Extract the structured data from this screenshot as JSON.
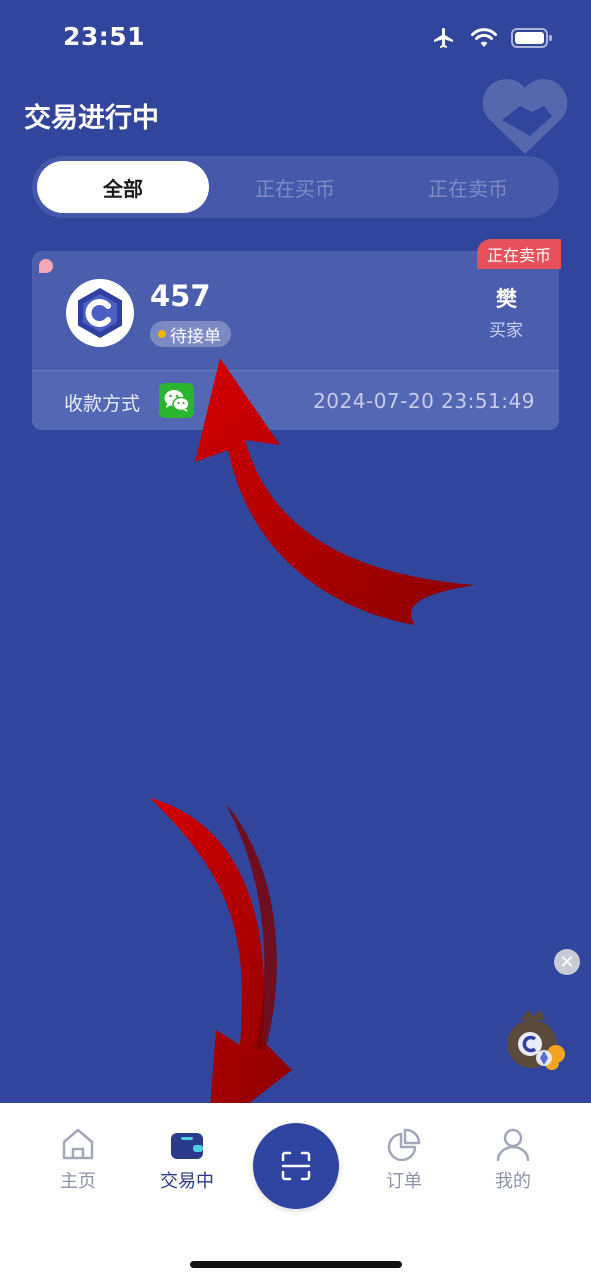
{
  "status_bar": {
    "time": "23:51"
  },
  "header": {
    "title": "交易进行中"
  },
  "segments": [
    {
      "label": "全部",
      "active": true
    },
    {
      "label": "正在买币",
      "active": false
    },
    {
      "label": "正在卖币",
      "active": false
    }
  ],
  "order": {
    "ribbon": "正在卖币",
    "amount": "457",
    "status": "待接单",
    "party_name": "樊",
    "party_role": "买家",
    "payment_label": "收款方式",
    "payment_icon": "wechat-icon",
    "time": "2024-07-20 23:51:49"
  },
  "colors": {
    "background": "#31459c",
    "accent_red": "#e6505a",
    "wechat_green": "#2bb52e",
    "status_dot": "#f0b400",
    "tab_active": "#2a3a8c"
  },
  "tabbar": {
    "items": [
      {
        "label": "主页",
        "icon": "home-icon",
        "active": false
      },
      {
        "label": "交易中",
        "icon": "wallet-icon",
        "active": true
      },
      {
        "label": "订单",
        "icon": "pie-chart-icon",
        "active": false
      },
      {
        "label": "我的",
        "icon": "user-icon",
        "active": false
      }
    ],
    "center_icon": "scan-icon"
  }
}
